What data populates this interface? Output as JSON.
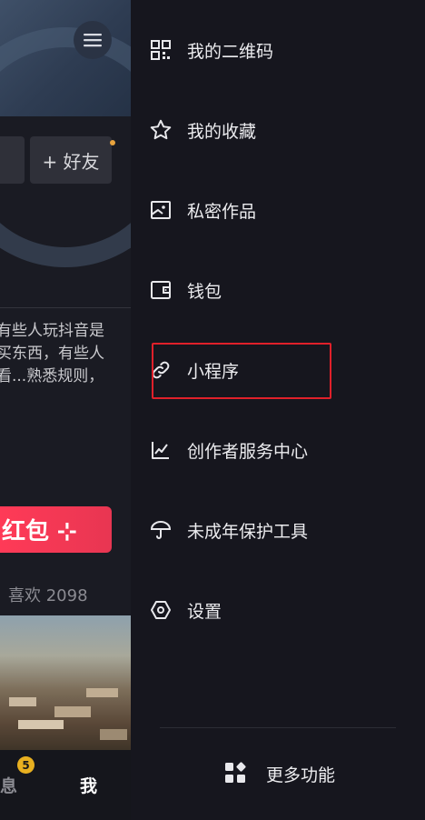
{
  "left_page": {
    "add_friend_button": "+ 好友",
    "bio_lines": [
      "有些人玩抖音是",
      "买东西，有些人",
      "看...熟悉规则，"
    ],
    "red_packet_label": "红包 ⊹",
    "likes_text": "喜欢 2098",
    "bottom_nav": {
      "messages_label": "息",
      "messages_badge": "5",
      "me_label": "我"
    }
  },
  "drawer": {
    "items": [
      {
        "label": "我的二维码",
        "icon": "qr-code-icon"
      },
      {
        "label": "我的收藏",
        "icon": "star-icon"
      },
      {
        "label": "私密作品",
        "icon": "private-image-icon"
      },
      {
        "label": "钱包",
        "icon": "wallet-icon"
      },
      {
        "label": "小程序",
        "icon": "link-icon"
      },
      {
        "label": "创作者服务中心",
        "icon": "chart-icon"
      },
      {
        "label": "未成年保护工具",
        "icon": "umbrella-icon"
      },
      {
        "label": "设置",
        "icon": "settings-hex-icon"
      }
    ],
    "more_label": "更多功能"
  },
  "colors": {
    "background": "#16161e",
    "highlight_border": "#e0202a",
    "red_packet": "#ff3a57",
    "badge": "#e8b020"
  }
}
